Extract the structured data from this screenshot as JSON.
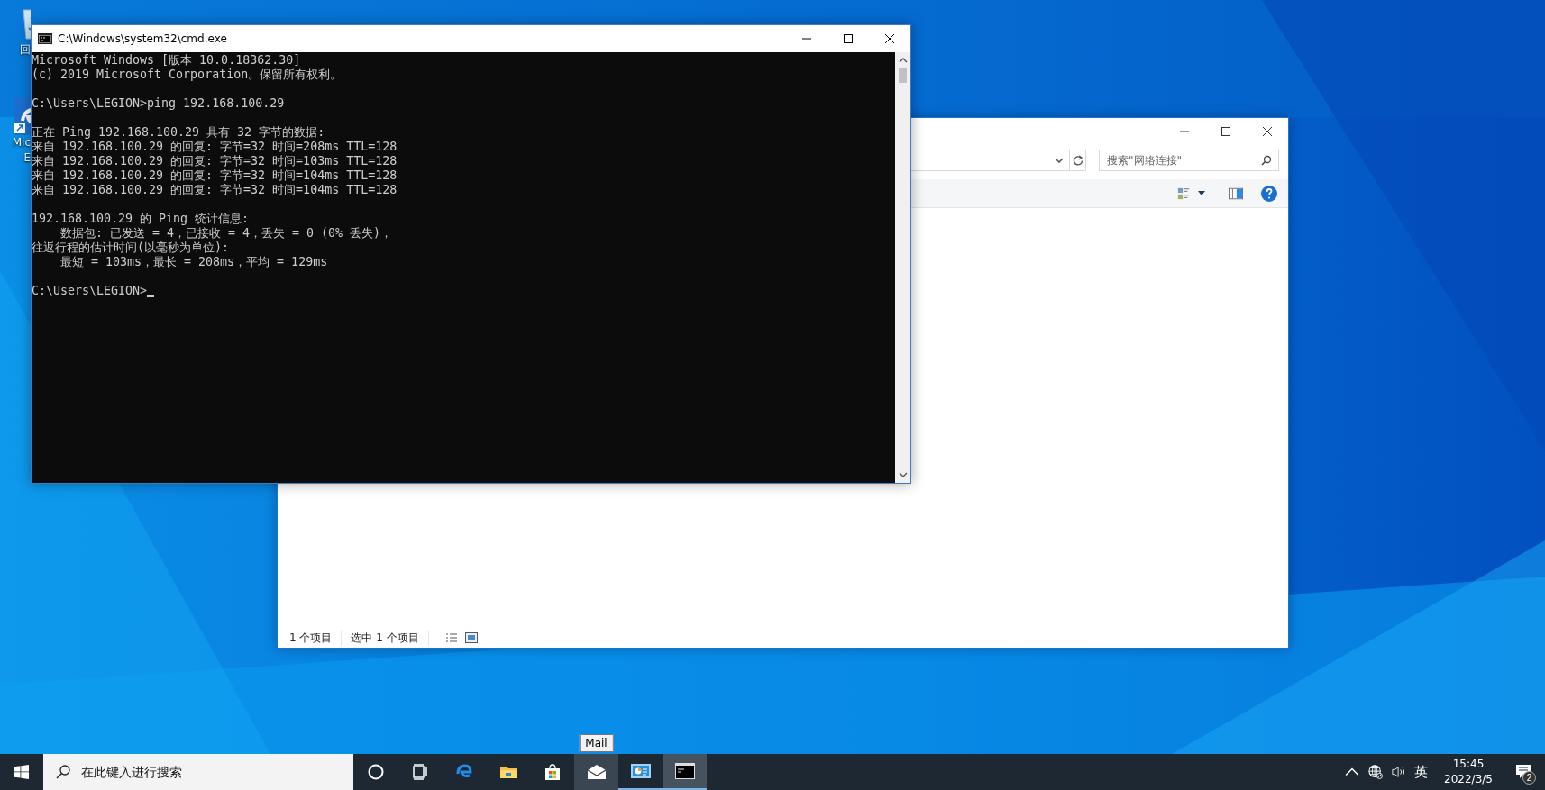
{
  "desktop": {
    "icons": [
      {
        "kind": "recycle-bin",
        "label_lines": [
          "回"
        ]
      },
      {
        "kind": "edge-shortcut",
        "label_lines": [
          "Mic",
          "E"
        ]
      }
    ]
  },
  "cmd_window": {
    "title": "C:\\Windows\\system32\\cmd.exe",
    "blocks": [
      [
        "Microsoft Windows [版本 10.0.18362.30]",
        "(c) 2019 Microsoft Corporation。保留所有权利。"
      ],
      [
        "C:\\Users\\LEGION>ping 192.168.100.29"
      ],
      [
        "正在 Ping 192.168.100.29 具有 32 字节的数据:",
        "来自 192.168.100.29 的回复: 字节=32 时间=208ms TTL=128",
        "来自 192.168.100.29 的回复: 字节=32 时间=103ms TTL=128",
        "来自 192.168.100.29 的回复: 字节=32 时间=104ms TTL=128",
        "来自 192.168.100.29 的回复: 字节=32 时间=104ms TTL=128"
      ],
      [
        "192.168.100.29 的 Ping 统计信息:",
        "    数据包: 已发送 = 4，已接收 = 4，丢失 = 0 (0% 丢失)，",
        "往返行程的估计时间(以毫秒为单位):",
        "    最短 = 103ms，最长 = 208ms，平均 = 129ms"
      ],
      [
        "C:\\Users\\LEGION>"
      ]
    ],
    "cursor": true
  },
  "explorer_window": {
    "search": {
      "placeholder": "搜索\"网络连接\""
    },
    "status_bar": [
      "1 个项目",
      "选中 1 个项目"
    ]
  },
  "taskbar": {
    "search": {
      "placeholder": "在此键入进行搜索"
    },
    "apps": [
      {
        "kind": "cortana",
        "running": false,
        "selected": false
      },
      {
        "kind": "task-view",
        "running": false,
        "selected": false
      },
      {
        "kind": "edge",
        "running": false,
        "selected": false
      },
      {
        "kind": "file-explorer",
        "running": false,
        "selected": false
      },
      {
        "kind": "store",
        "running": false,
        "selected": false
      },
      {
        "kind": "mail",
        "running": false,
        "selected": false,
        "hovered": true,
        "tooltip": "Mail"
      },
      {
        "kind": "control-panel",
        "running": true,
        "selected": false
      },
      {
        "kind": "cmd",
        "running": true,
        "selected": true
      }
    ],
    "tray": {
      "ime": "英",
      "time": "15:45",
      "date": "2022/3/5",
      "notifications": "2"
    }
  }
}
